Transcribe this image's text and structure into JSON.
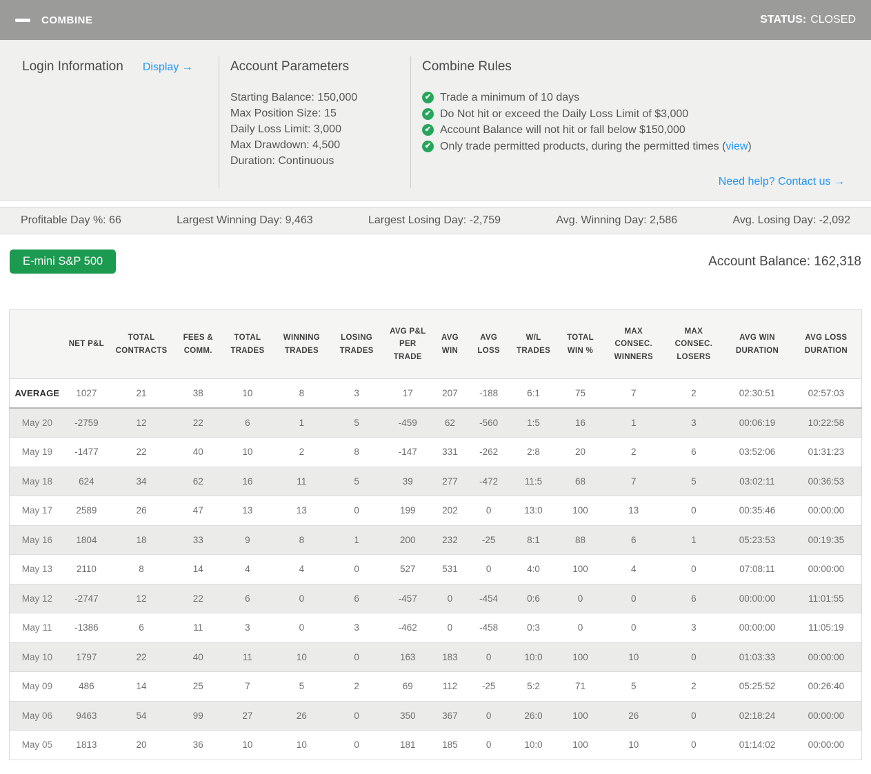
{
  "header": {
    "title": "COMBINE",
    "status_label": "STATUS:",
    "status_value": "CLOSED"
  },
  "info_panel": {
    "login": {
      "title": "Login Information",
      "display_link": "Display →"
    },
    "account_parameters": {
      "title": "Account Parameters",
      "items": [
        "Starting Balance: 150,000",
        "Max Position Size: 15",
        "Daily Loss Limit: 3,000",
        "Max Drawdown: 4,500",
        "Duration: Continuous"
      ]
    },
    "combine_rules": {
      "title": "Combine Rules",
      "items": [
        {
          "text": "Trade a minimum of 10 days"
        },
        {
          "text": "Do Not hit or exceed the Daily Loss Limit of $3,000"
        },
        {
          "text": "Account Balance will not hit or fall below $150,000"
        },
        {
          "text": "Only trade permitted products, during the permitted times (",
          "link": "view",
          "suffix": ")"
        }
      ],
      "help_link": "Need help? Contact us →"
    }
  },
  "stats_bar": [
    "Profitable Day %: 66",
    "Largest Winning Day: 9,463",
    "Largest Losing Day: -2,759",
    "Avg. Winning Day: 2,586",
    "Avg. Losing Day: -2,092"
  ],
  "account": {
    "product_button": "E-mini S&P 500",
    "balance": "Account Balance: 162,318"
  },
  "table": {
    "columns": [
      "",
      "NET P&L",
      "TOTAL CONTRACTS",
      "FEES & COMM.",
      "TOTAL TRADES",
      "WINNING TRADES",
      "LOSING TRADES",
      "AVG P&L PER TRADE",
      "AVG WIN",
      "AVG LOSS",
      "W/L TRADES",
      "TOTAL WIN %",
      "MAX CONSEC. WINNERS",
      "MAX CONSEC. LOSERS",
      "AVG WIN DURATION",
      "AVG LOSS DURATION"
    ],
    "rows": [
      {
        "label": "AVERAGE",
        "values": [
          "1027",
          "21",
          "38",
          "10",
          "8",
          "3",
          "17",
          "207",
          "-188",
          "6:1",
          "75",
          "7",
          "2",
          "02:30:51",
          "02:57:03"
        ]
      },
      {
        "label": "May 20",
        "values": [
          "-2759",
          "12",
          "22",
          "6",
          "1",
          "5",
          "-459",
          "62",
          "-560",
          "1:5",
          "16",
          "1",
          "3",
          "00:06:19",
          "10:22:58"
        ]
      },
      {
        "label": "May 19",
        "values": [
          "-1477",
          "22",
          "40",
          "10",
          "2",
          "8",
          "-147",
          "331",
          "-262",
          "2:8",
          "20",
          "2",
          "6",
          "03:52:06",
          "01:31:23"
        ]
      },
      {
        "label": "May 18",
        "values": [
          "624",
          "34",
          "62",
          "16",
          "11",
          "5",
          "39",
          "277",
          "-472",
          "11:5",
          "68",
          "7",
          "5",
          "03:02:11",
          "00:36:53"
        ]
      },
      {
        "label": "May 17",
        "values": [
          "2589",
          "26",
          "47",
          "13",
          "13",
          "0",
          "199",
          "202",
          "0",
          "13:0",
          "100",
          "13",
          "0",
          "00:35:46",
          "00:00:00"
        ]
      },
      {
        "label": "May 16",
        "values": [
          "1804",
          "18",
          "33",
          "9",
          "8",
          "1",
          "200",
          "232",
          "-25",
          "8:1",
          "88",
          "6",
          "1",
          "05:23:53",
          "00:19:35"
        ]
      },
      {
        "label": "May 13",
        "values": [
          "2110",
          "8",
          "14",
          "4",
          "4",
          "0",
          "527",
          "531",
          "0",
          "4:0",
          "100",
          "4",
          "0",
          "07:08:11",
          "00:00:00"
        ]
      },
      {
        "label": "May 12",
        "values": [
          "-2747",
          "12",
          "22",
          "6",
          "0",
          "6",
          "-457",
          "0",
          "-454",
          "0:6",
          "0",
          "0",
          "6",
          "00:00:00",
          "11:01:55"
        ]
      },
      {
        "label": "May 11",
        "values": [
          "-1386",
          "6",
          "11",
          "3",
          "0",
          "3",
          "-462",
          "0",
          "-458",
          "0:3",
          "0",
          "0",
          "3",
          "00:00:00",
          "11:05:19"
        ]
      },
      {
        "label": "May 10",
        "values": [
          "1797",
          "22",
          "40",
          "11",
          "10",
          "0",
          "163",
          "183",
          "0",
          "10:0",
          "100",
          "10",
          "0",
          "01:03:33",
          "00:00:00"
        ]
      },
      {
        "label": "May 09",
        "values": [
          "486",
          "14",
          "25",
          "7",
          "5",
          "2",
          "69",
          "112",
          "-25",
          "5:2",
          "71",
          "5",
          "2",
          "05:25:52",
          "00:26:40"
        ]
      },
      {
        "label": "May 06",
        "values": [
          "9463",
          "54",
          "99",
          "27",
          "26",
          "0",
          "350",
          "367",
          "0",
          "26:0",
          "100",
          "26",
          "0",
          "02:18:24",
          "00:00:00"
        ]
      },
      {
        "label": "May 05",
        "values": [
          "1813",
          "20",
          "36",
          "10",
          "10",
          "0",
          "181",
          "185",
          "0",
          "10:0",
          "100",
          "10",
          "0",
          "01:14:02",
          "00:00:00"
        ]
      }
    ]
  },
  "colors": {
    "header_bg": "#9b9b99",
    "header_text": "#ffffff",
    "panel_bg": "#f0f0ee",
    "divider": "#cccccb",
    "heading_text": "#4b4b4b",
    "body_text": "#565656",
    "link_blue": "#2196f3",
    "check_green": "#26a65b",
    "stats_bg": "#f0f0ee",
    "stats_border": "#d8d8d6",
    "button_green": "#1b9a50",
    "button_text": "#ffffff",
    "balance_text": "#454545",
    "table_border": "#d9d9d7",
    "table_header_bg": "#f5f5f3",
    "header_cell_text": "#3f3f3f",
    "cell_text": "#6e6e6e",
    "label_text": "#7d7d7d",
    "average_text": "#2e2e2e",
    "stripe_bg": "#ebebe9",
    "row_divider": "#dcdcda",
    "average_divider": "#b8b8b6"
  }
}
